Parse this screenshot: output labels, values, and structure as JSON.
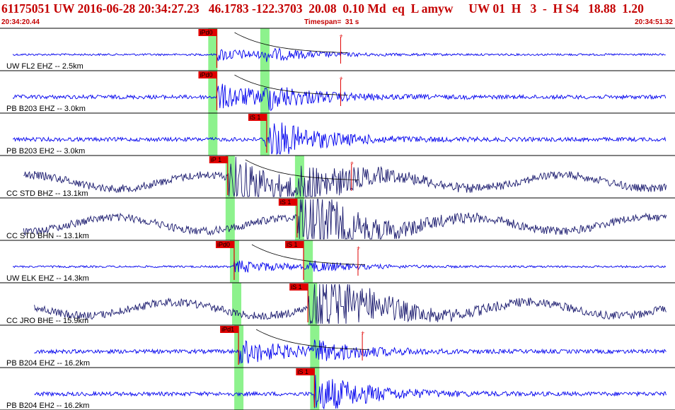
{
  "header": {
    "title": "61175051 UW 2016-06-28 20:34:27.23   46.1783 -122.3703  20.08  0.10 Md  eq  L amyw     UW 01  H   3  -  H S4   18.88  1.20",
    "time_start": "20:34:20.44",
    "timespan": "Timespan=  31 s",
    "time_end": "20:34:51.32"
  },
  "colors": {
    "header_text": "#c40000",
    "trace_blue": "#0000ee",
    "trace_navy": "#1a1a6e",
    "pick_red": "#e00000",
    "window_green": "#8df28d",
    "coda_black": "#000000",
    "frame": "#000000"
  },
  "chart_data": {
    "type": "seismogram",
    "time_axis_seconds": [
      0,
      31
    ],
    "channels": [
      {
        "label": "UW FL2 EHZ -- 2.5km",
        "color": "blue",
        "amplitude": "low",
        "picks": [
          {
            "label": "iPd0",
            "t": 10.0
          }
        ],
        "green_windows": [
          9.8,
          12.2
        ],
        "coda_fit": true,
        "trace_span": [
          0,
          31
        ]
      },
      {
        "label": "PB B203 EHZ -- 3.0km",
        "color": "blue",
        "amplitude": "medium",
        "picks": [
          {
            "label": "iPd0",
            "t": 10.0
          }
        ],
        "green_windows": [
          9.8,
          12.2
        ],
        "coda_fit": true,
        "trace_span": [
          0,
          31
        ]
      },
      {
        "label": "PB B203 EH2 -- 3.0km",
        "color": "blue",
        "amplitude": "medium",
        "picks": [
          {
            "label": "iS 1",
            "t": 12.3
          }
        ],
        "green_windows": [
          9.8,
          12.2
        ],
        "coda_fit": false,
        "trace_span": [
          0,
          31
        ]
      },
      {
        "label": "CC STD BHZ -- 13.1km",
        "color": "navy",
        "amplitude": "high",
        "picks": [
          {
            "label": "iP 1",
            "t": 10.5
          }
        ],
        "green_windows": [
          10.6,
          13.8
        ],
        "coda_fit": true,
        "trace_span": [
          0.5,
          31
        ]
      },
      {
        "label": "CC STD BHN -- 13.1km",
        "color": "navy",
        "amplitude": "high",
        "picks": [
          {
            "label": "iS 1",
            "t": 13.7
          }
        ],
        "green_windows": [
          10.6,
          13.8
        ],
        "coda_fit": false,
        "trace_span": [
          0.5,
          31
        ]
      },
      {
        "label": "UW ELK EHZ -- 14.3km",
        "color": "blue",
        "amplitude": "low",
        "picks": [
          {
            "label": "iPd0",
            "t": 10.8
          },
          {
            "label": "iS 1",
            "t": 14.0
          }
        ],
        "green_windows": [
          10.8,
          14.2
        ],
        "coda_fit": true,
        "trace_span": [
          0,
          31
        ]
      },
      {
        "label": "CC JRO BHE -- 15.9km",
        "color": "navy",
        "amplitude": "high",
        "picks": [
          {
            "label": "iS 1",
            "t": 14.2
          }
        ],
        "green_windows": [
          10.9,
          14.4
        ],
        "coda_fit": false,
        "trace_span": [
          1.0,
          31
        ]
      },
      {
        "label": "PB B204 EHZ -- 16.2km",
        "color": "blue",
        "amplitude": "medium",
        "picks": [
          {
            "label": "iPd1",
            "t": 11.0
          }
        ],
        "green_windows": [
          11.0,
          14.5
        ],
        "coda_fit": true,
        "trace_span": [
          1.0,
          31
        ]
      },
      {
        "label": "PB B204 EH2 -- 16.2km",
        "color": "blue",
        "amplitude": "medium",
        "picks": [
          {
            "label": "iS 1",
            "t": 14.5
          }
        ],
        "green_windows": [
          11.0,
          14.5
        ],
        "coda_fit": false,
        "trace_span": [
          1.0,
          31
        ]
      }
    ]
  }
}
